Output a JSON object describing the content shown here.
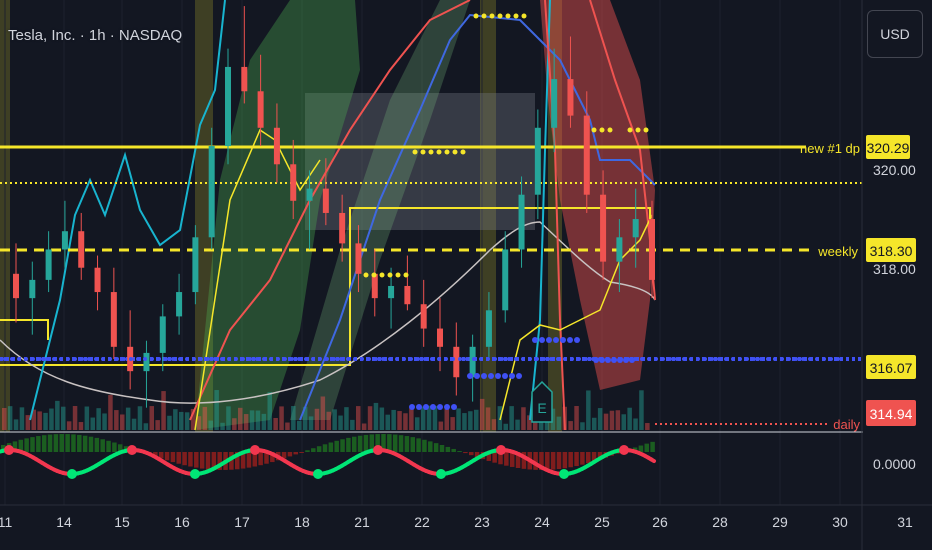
{
  "symbol_title": "Tesla, Inc. · 1h · NASDAQ",
  "currency_button": "USD",
  "colors": {
    "background": "#131722",
    "yellow": "#f5e62a",
    "bull": "#26a69a",
    "bear": "#ef5350",
    "blue_dots": "#3f51f5",
    "cyan_line": "#18b4cf",
    "osc_up": "#00e676",
    "osc_down": "#f2374f"
  },
  "levels": [
    {
      "name": "new #1 dp",
      "value": "320.29",
      "style": "solid"
    },
    {
      "name": "weekly",
      "value": "318.30",
      "style": "dashed"
    },
    {
      "name": "",
      "value": "316.07",
      "style": "dotted-blue"
    },
    {
      "name": "daily",
      "value": "314.94",
      "style": "dotted-red"
    }
  ],
  "partial_price_labels": [
    "320.00",
    "318.00"
  ],
  "oscillator_value": "0.0000",
  "x_axis_labels": [
    "11",
    "14",
    "15",
    "16",
    "17",
    "18",
    "21",
    "22",
    "23",
    "24",
    "25",
    "26",
    "28",
    "29",
    "30",
    "31"
  ],
  "marker_letter": "E",
  "chart_data": {
    "type": "candlestick",
    "title": "Tesla, Inc. · 1h · NASDAQ",
    "ylim": [
      314.6,
      321.7
    ],
    "horizontal_lines": [
      320.29,
      318.3,
      316.07,
      314.94
    ],
    "candles_ohlc": [
      [
        317.2,
        317.7,
        316.4,
        316.8
      ],
      [
        316.8,
        317.4,
        316.2,
        317.1
      ],
      [
        317.1,
        317.9,
        316.9,
        317.6
      ],
      [
        317.6,
        318.4,
        317.3,
        317.9
      ],
      [
        317.9,
        318.2,
        317.1,
        317.3
      ],
      [
        317.3,
        317.5,
        316.6,
        316.9
      ],
      [
        316.9,
        317.3,
        315.8,
        316.0
      ],
      [
        316.0,
        316.6,
        315.3,
        315.6
      ],
      [
        315.6,
        316.1,
        315.0,
        315.9
      ],
      [
        315.9,
        316.7,
        315.6,
        316.5
      ],
      [
        316.5,
        317.2,
        316.2,
        316.9
      ],
      [
        316.9,
        318.0,
        316.7,
        317.8
      ],
      [
        317.8,
        319.6,
        317.6,
        319.3
      ],
      [
        319.3,
        320.9,
        319.0,
        320.6
      ],
      [
        320.6,
        321.6,
        320.0,
        320.2
      ],
      [
        320.2,
        320.8,
        319.3,
        319.6
      ],
      [
        319.6,
        320.0,
        318.7,
        319.0
      ],
      [
        319.0,
        319.4,
        318.1,
        318.4
      ],
      [
        318.4,
        318.9,
        317.6,
        318.6
      ],
      [
        318.6,
        319.1,
        318.0,
        318.2
      ],
      [
        318.2,
        318.5,
        317.4,
        317.7
      ],
      [
        317.7,
        318.0,
        316.9,
        317.2
      ],
      [
        317.2,
        317.6,
        316.5,
        316.8
      ],
      [
        316.8,
        317.3,
        316.3,
        317.0
      ],
      [
        317.0,
        317.5,
        316.6,
        316.7
      ],
      [
        316.7,
        317.1,
        316.0,
        316.3
      ],
      [
        316.3,
        316.8,
        315.6,
        316.0
      ],
      [
        316.0,
        316.4,
        315.2,
        315.5
      ],
      [
        315.5,
        316.2,
        315.1,
        316.0
      ],
      [
        316.0,
        316.9,
        315.8,
        316.6
      ],
      [
        316.6,
        317.9,
        316.4,
        317.6
      ],
      [
        317.6,
        318.8,
        317.3,
        318.5
      ],
      [
        318.5,
        319.9,
        318.1,
        319.6
      ],
      [
        319.6,
        320.9,
        319.2,
        320.4
      ],
      [
        320.4,
        321.1,
        319.6,
        319.8
      ],
      [
        319.8,
        320.2,
        318.2,
        318.5
      ],
      [
        318.5,
        318.9,
        317.1,
        317.4
      ],
      [
        317.4,
        318.1,
        316.9,
        317.8
      ],
      [
        317.8,
        318.6,
        317.3,
        318.1
      ],
      [
        318.1,
        318.4,
        316.8,
        317.1
      ]
    ],
    "oscillator": {
      "zero_label": "0.0000",
      "turning_points": [
        "up",
        "down",
        "up",
        "down",
        "up",
        "down",
        "up"
      ]
    }
  }
}
